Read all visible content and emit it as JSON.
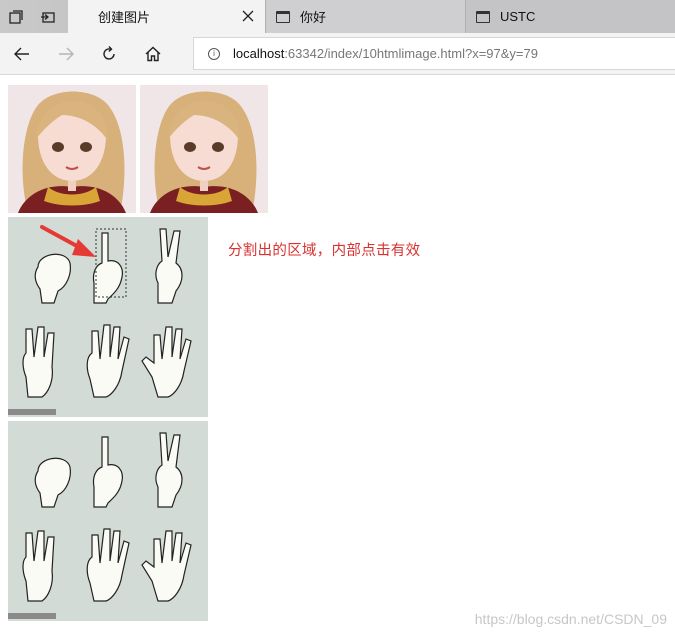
{
  "browser": {
    "tabs": [
      {
        "title": "创建图片",
        "active": true
      },
      {
        "title": "你好",
        "active": false
      },
      {
        "title": "USTC",
        "active": false
      }
    ],
    "address": {
      "host": "localhost",
      "path": ":63342/index/10htmlimage.html?x=97&y=79"
    }
  },
  "page": {
    "annotation": "分割出的区域，内部点击有效",
    "watermark": "https://blog.csdn.net/CSDN_09"
  },
  "colors": {
    "annotation": "#d93030",
    "arrow": "#e53935",
    "hand_bg": "#d2dbd6"
  }
}
